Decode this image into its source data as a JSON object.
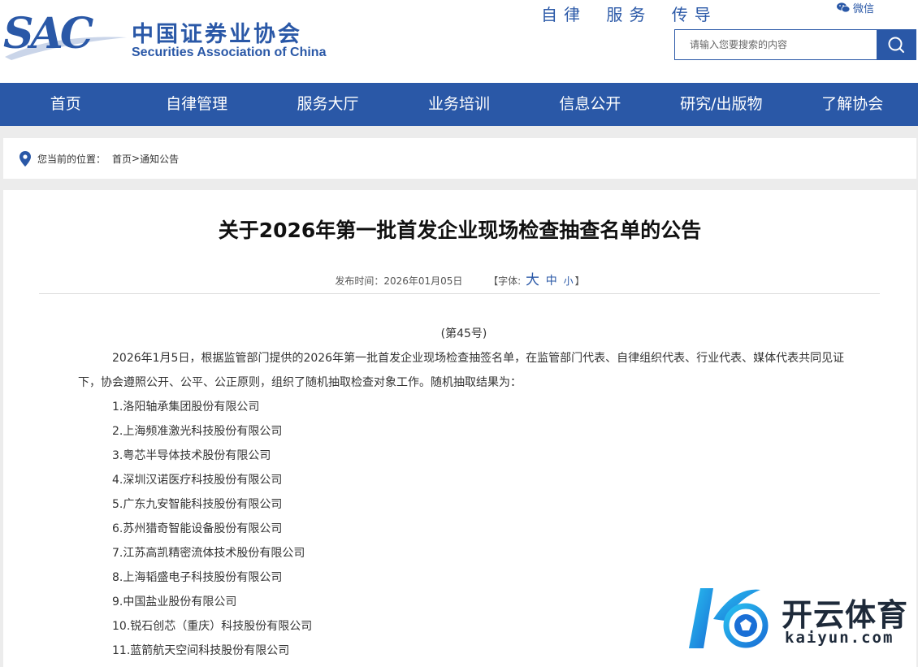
{
  "header": {
    "logo_abbr": "SAC",
    "logo_cn": "中国证券业协会",
    "logo_en": "Securities Association of China",
    "slogan": "自律 服务 传导",
    "wechat_label": "微信",
    "search": {
      "placeholder": "请输入您要搜索的内容"
    }
  },
  "nav": {
    "items": [
      {
        "label": "首页"
      },
      {
        "label": "自律管理"
      },
      {
        "label": "服务大厅"
      },
      {
        "label": "业务培训"
      },
      {
        "label": "信息公开"
      },
      {
        "label": "研究/出版物"
      },
      {
        "label": "了解协会"
      }
    ]
  },
  "breadcrumb": {
    "prefix": "您当前的位置：",
    "home": "首页",
    "separator": ">",
    "current": "通知公告"
  },
  "article": {
    "title": "关于2026年第一批首发企业现场检查抽查名单的公告",
    "publish_label": "发布时间：",
    "publish_date": "2026年01月05日",
    "font_label": "【字体:",
    "font_large": "大",
    "font_medium": "中",
    "font_small": "小",
    "font_close": "】",
    "doc_no": "(第45号)",
    "paragraph": "2026年1月5日，根据监管部门提供的2026年第一批首发企业现场检查抽签名单，在监管部门代表、自律组织代表、行业代表、媒体代表共同见证下，协会遵照公开、公平、公正原则，组织了随机抽取检查对象工作。随机抽取结果为：",
    "companies": [
      "1.洛阳轴承集团股份有限公司",
      "2.上海频准激光科技股份有限公司",
      "3.粤芯半导体技术股份有限公司",
      "4.深圳汉诺医疗科技股份有限公司",
      "5.广东九安智能科技股份有限公司",
      "6.苏州猎奇智能设备股份有限公司",
      "7.江苏高凯精密流体技术股份有限公司",
      "8.上海韬盛电子科技股份有限公司",
      "9.中国盐业股份有限公司",
      "10.锐石创芯（重庆）科技股份有限公司",
      "11.蓝箭航天空间科技股份有限公司"
    ]
  },
  "watermark": {
    "cn": "开云体育",
    "en": "kaiyun.com"
  },
  "colors": {
    "brand_blue": "#2a58a7",
    "page_bg": "#ececec"
  }
}
